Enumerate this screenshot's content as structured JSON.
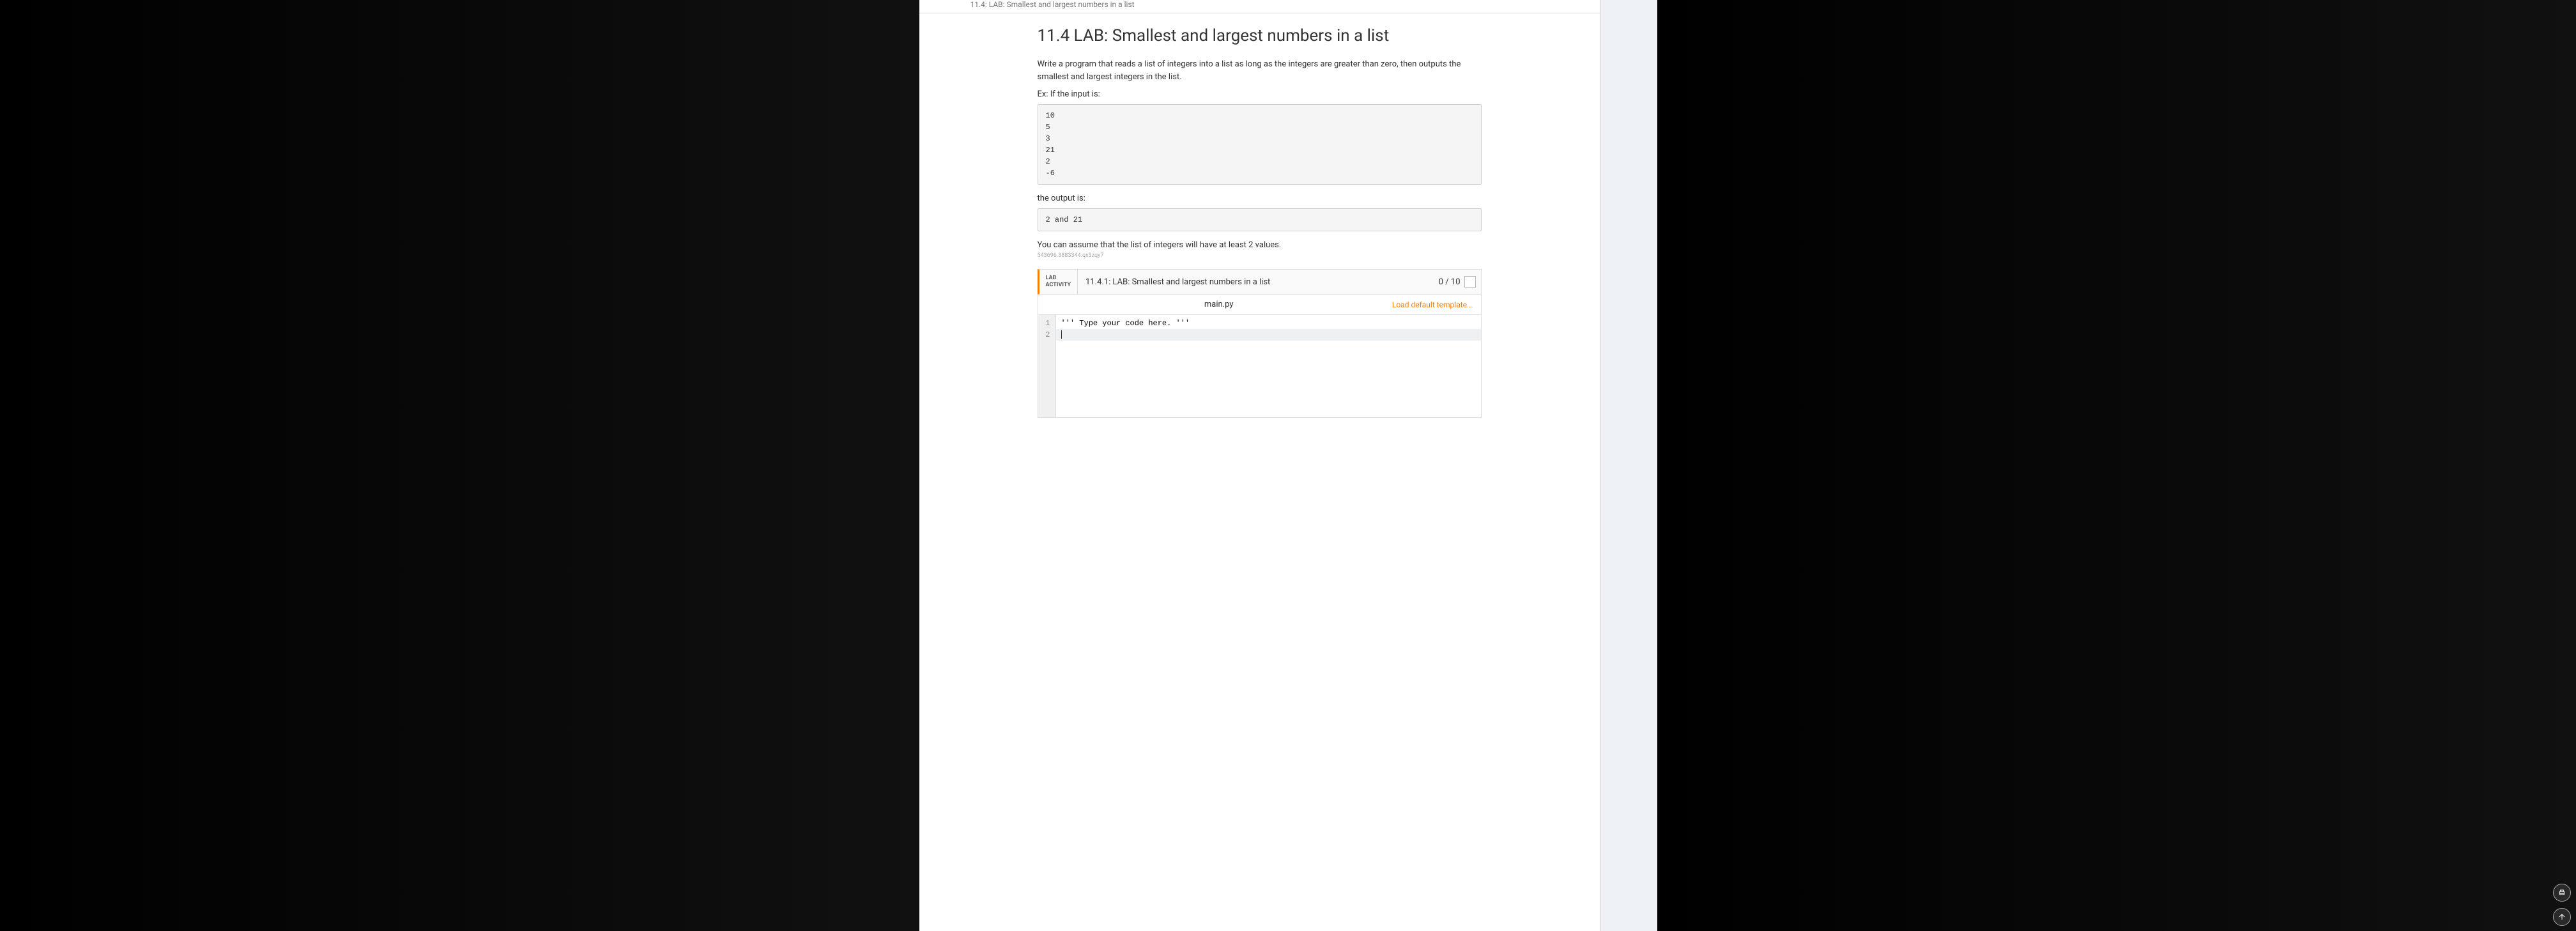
{
  "breadcrumb": "11.4: LAB: Smallest and largest numbers in a list",
  "page": {
    "title": "11.4 LAB: Smallest and largest numbers in a list",
    "description": "Write a program that reads a list of integers into a list as long as the integers are greater than zero, then outputs the smallest and largest integers in the list.",
    "ex_if_input": "Ex: If the input is:",
    "input_block": "10\n5\n3\n21\n2\n-6",
    "output_label": "the output is:",
    "output_block": "2 and 21",
    "assume_note": "You can assume that the list of integers will have at least 2 values.",
    "tiny_id": "543696.3883344.qx3zqy7"
  },
  "lab": {
    "tag_line1": "LAB",
    "tag_line2": "ACTIVITY",
    "title": "11.4.1: LAB: Smallest and largest numbers in a list",
    "score": "0 / 10"
  },
  "editor": {
    "filename": "main.py",
    "load_template": "Load default template...",
    "gutter": [
      "1",
      "2"
    ],
    "line1": "''' Type your code here. '''",
    "line2": ""
  }
}
